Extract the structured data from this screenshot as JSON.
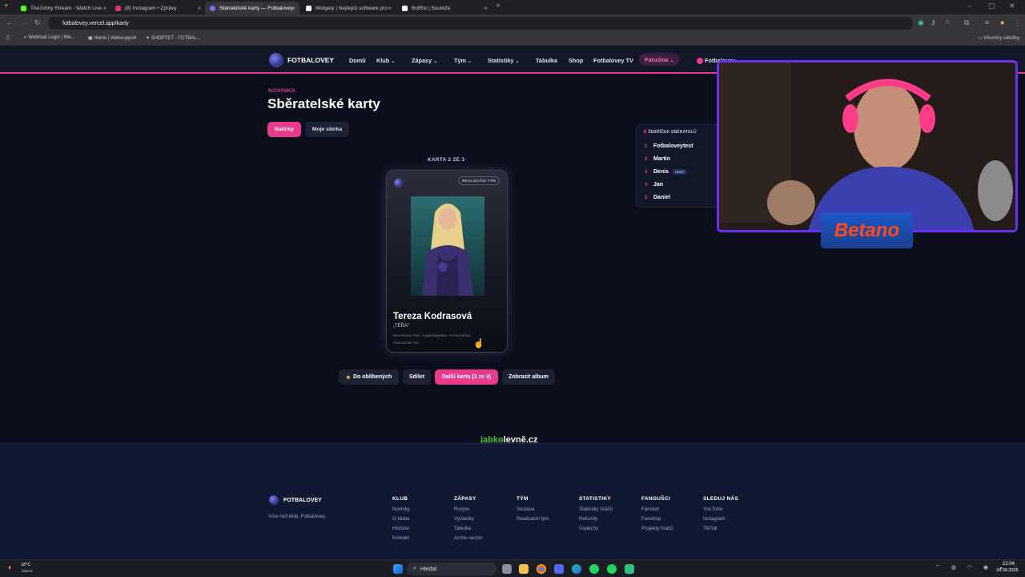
{
  "browser": {
    "tabs": [
      {
        "label": "TheJohny Stream - Watch Live",
        "color": "#53fc18"
      },
      {
        "label": "(8) Instagram • Zprávy",
        "color": "#e1306c"
      },
      {
        "label": "Sběratelské karty — Fotbalovey",
        "color": "#7b6cf0"
      },
      {
        "label": "Widgety | Nejlepší software pro",
        "color": "#ffffff"
      },
      {
        "label": "BotRix | Soutěže",
        "color": "#ffffff"
      }
    ],
    "url": "fotbalovey.vercel.app/karty",
    "bookmarks": [
      "Webmail Login | We...",
      "Home | Websupport",
      "SHOPTET - FOTBAL..."
    ],
    "all_bookmarks": "Všechny záložky"
  },
  "site": {
    "brand": "FOTBALOVEY",
    "nav": [
      "Domů",
      "Klub",
      "Zápasy",
      "Tým",
      "Statistiky",
      "Tabulka",
      "Shop",
      "Fotbalovey TV",
      "Fanzóna"
    ],
    "nav_user": "Fotbalovey"
  },
  "page": {
    "eyebrow": "NOVINKA",
    "title": "Sběratelské karty",
    "tabs": [
      "Balíčky",
      "Moje sbírka"
    ],
    "counter": "KARTA 2 ZE 3"
  },
  "card": {
    "badge": "REALIZAČNÍ TÝM",
    "name": "Tereza Kodrasová",
    "nickname": "„TERA\"",
    "roles": "NAJVTESKA TÝMU · KAMERAMANKA · FOTOGRAFKA ·",
    "team": "REALIZAČNÍ TÝM"
  },
  "leaderboard": {
    "title": "ŽEBŘÍČEK SBĚRATELŮ",
    "rows": [
      {
        "rank": "1",
        "name": "Fotbaloveytest",
        "tag": ""
      },
      {
        "rank": "2",
        "name": "Martin",
        "tag": ""
      },
      {
        "rank": "3",
        "name": "Denis",
        "tag": "HRÁČ"
      },
      {
        "rank": "4",
        "name": "Jan",
        "tag": ""
      },
      {
        "rank": "5",
        "name": "Daniel",
        "tag": ""
      }
    ]
  },
  "actions": {
    "favorite": "Do oblíbených",
    "share": "Sdílet",
    "next": "Další karta (3 ze 3)",
    "album": "Zobrazit album"
  },
  "sponsor": {
    "a": "jabk",
    "b": "levně.cz"
  },
  "overlay": {
    "betano": "Betano"
  },
  "footer": {
    "brand": "FOTBALOVEY",
    "tagline": "Více než klub. Fotbalovey.",
    "columns": [
      {
        "heading": "KLUB",
        "links": [
          "Novinky",
          "O klubu",
          "Historie",
          "Kontakt"
        ]
      },
      {
        "heading": "ZÁPASY",
        "links": [
          "Rozpis",
          "Výsledky",
          "Tabulka",
          "Archiv sezón"
        ]
      },
      {
        "heading": "TÝM",
        "links": [
          "Sestava",
          "Realizační tým"
        ]
      },
      {
        "heading": "STATISTIKY",
        "links": [
          "Statistiky hráčů",
          "Rekordy",
          "Úspěchy"
        ]
      },
      {
        "heading": "FANOUŠCI",
        "links": [
          "Fanclub",
          "Fanshop",
          "Projekty hráčů"
        ]
      },
      {
        "heading": "SLEDUJ NÁS",
        "links": [
          "YouTube",
          "Instagram",
          "TikTok"
        ]
      }
    ]
  },
  "taskbar": {
    "temp": "18°C",
    "weather": "Jasno",
    "search": "Hledat",
    "time": "22:04",
    "date": "24.08.2026"
  },
  "colors": {
    "accent": "#e93a8e",
    "webcam_border": "#6b2ff0"
  }
}
